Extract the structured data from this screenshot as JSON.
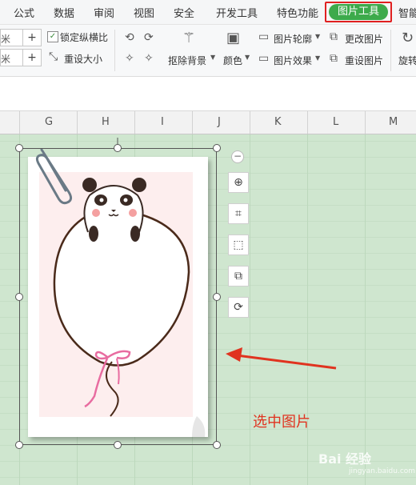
{
  "tabs": [
    "公式",
    "数据",
    "审阅",
    "视图",
    "安全",
    "开发工具",
    "特色功能",
    "图片工具",
    "智能"
  ],
  "toolbar": {
    "lock_ratio": "锁定纵横比",
    "reset_size": "重设大小",
    "remove_bg": "抠除背景",
    "color": "颜色",
    "outline": "图片轮廓",
    "effect": "图片效果",
    "change_pic": "更改图片",
    "reset_pic": "重设图片",
    "rotate": "旋转",
    "unit1": "米",
    "unit2": "米"
  },
  "columns": [
    "G",
    "H",
    "I",
    "J",
    "K",
    "L",
    "M"
  ],
  "annotation": "选中图片",
  "watermark": "Bai 经验",
  "watermark_sub": "jingyan.baidu.com",
  "colors": {
    "accent": "#3daa4b",
    "highlight": "#e02020",
    "arrow": "#e0331f"
  }
}
